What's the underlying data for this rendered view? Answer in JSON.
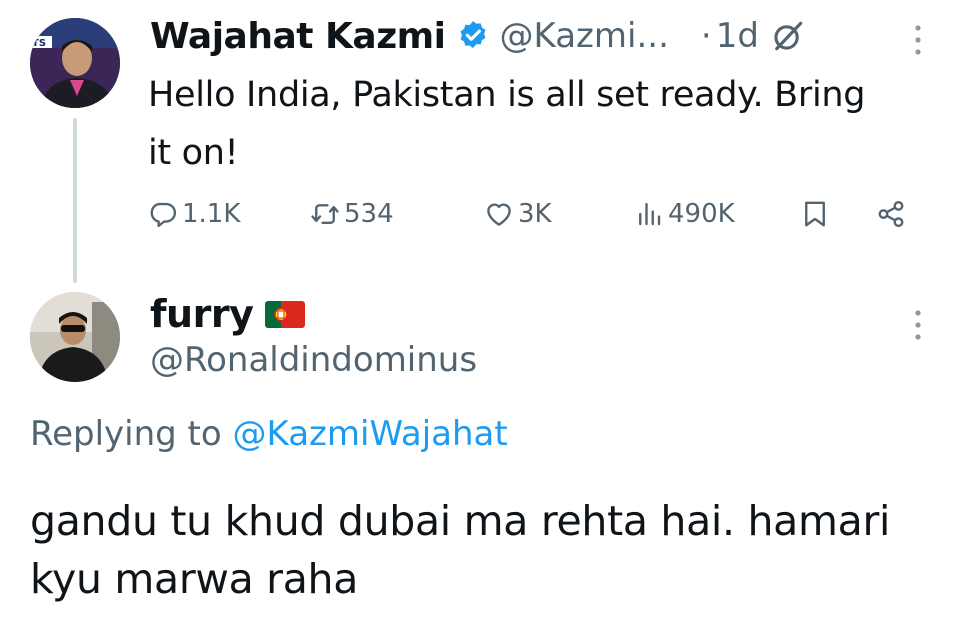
{
  "original_tweet": {
    "author_name": "Wajahat Kazmi",
    "author_handle": "@Kazmi...",
    "separator": "·",
    "time": "1d",
    "text": "Hello India, Pakistan is all set ready. Bring it on!",
    "stats": {
      "replies": "1.1K",
      "retweets": "534",
      "likes": "3K",
      "views": "490K"
    }
  },
  "reply_tweet": {
    "author_name": "furry",
    "author_handle": "@Ronaldindominus",
    "replying_prefix": "Replying to",
    "replying_to": "@KazmiWajahat",
    "text": "gandu tu khud dubai ma rehta hai. hamari kyu marwa raha"
  },
  "colors": {
    "text_primary": "#0f1419",
    "text_secondary": "#536471",
    "accent": "#1d9bf0",
    "thread_line": "#cfd9de"
  },
  "icons": {
    "verified": "verified-badge-icon",
    "grok": "grok-icon",
    "more": "more-vertical-icon",
    "reply": "reply-icon",
    "retweet": "retweet-icon",
    "like": "heart-icon",
    "views": "views-icon",
    "bookmark": "bookmark-icon",
    "share": "share-icon",
    "flag": "portugal-flag-icon"
  }
}
